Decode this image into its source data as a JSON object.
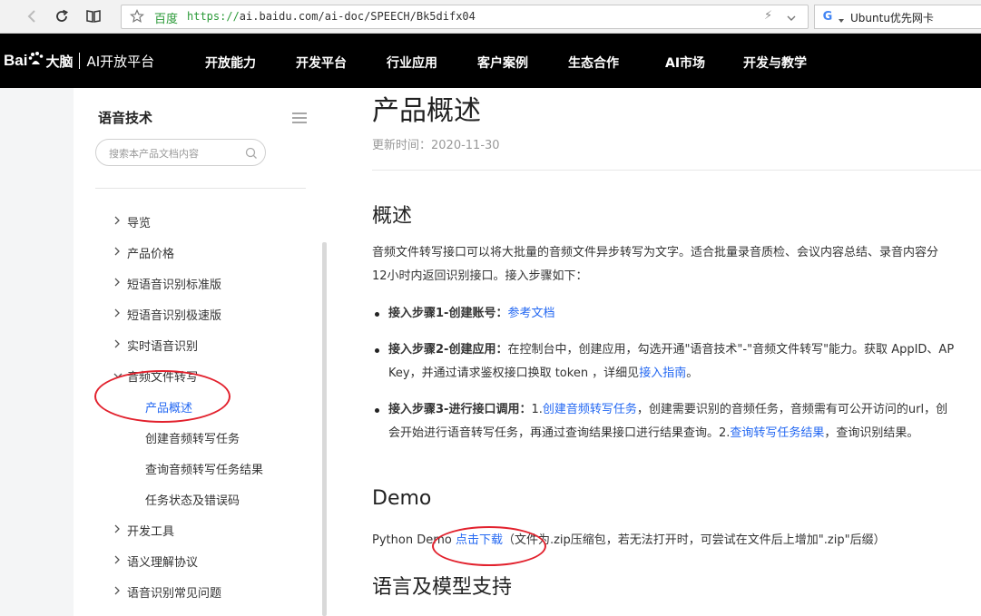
{
  "browser": {
    "brand_label": "百度",
    "url_scheme": "https://",
    "url_rest": "ai.baidu.com/ai-doc/SPEECH/Bk5difx04",
    "search_text": "Ubuntu优先网卡"
  },
  "header": {
    "logo_bai": "Bai",
    "logo_brain": "大脑",
    "logo_platform": "AI开放平台",
    "nav": [
      "开放能力",
      "开发平台",
      "行业应用",
      "客户案例",
      "生态合作",
      "AI市场",
      "开发与教学"
    ]
  },
  "sidebar": {
    "title": "语音技术",
    "search_placeholder": "搜索本产品文档内容",
    "items": [
      {
        "label": "导览"
      },
      {
        "label": "产品价格"
      },
      {
        "label": "短语音识别标准版"
      },
      {
        "label": "短语音识别极速版"
      },
      {
        "label": "实时语音识别"
      },
      {
        "label": "音频文件转写"
      },
      {
        "label": "产品概述"
      },
      {
        "label": "创建音频转写任务"
      },
      {
        "label": "查询音频转写任务结果"
      },
      {
        "label": "任务状态及错误码"
      },
      {
        "label": "开发工具"
      },
      {
        "label": "语义理解协议"
      },
      {
        "label": "语音识别常见问题"
      }
    ]
  },
  "content": {
    "title": "产品概述",
    "updated": "更新时间：2020-11-30",
    "overview_heading": "概述",
    "intro_line1": "音频文件转写接口可以将大批量的音频文件异步转写为文字。适合批量录音质检、会议内容总结、录音内容分",
    "intro_line2": "12小时内返回识别接口。接入步骤如下：",
    "step1_bold": "接入步骤1-创建账号：",
    "step1_link": "参考文档",
    "step2_bold": "接入步骤2-创建应用：",
    "step2_text": "在控制台中，创建应用，勾选开通\"语音技术\"-\"音频文件转写\"能力。获取 AppID、AP",
    "step2_line2": "Key，并通过请求鉴权接口换取 token ，详细见",
    "step2_link": "接入指南",
    "step2_end": "。",
    "step3_bold": "接入步骤3-进行接口调用：",
    "step3_pre": "1.",
    "step3_link1": "创建音频转写任务",
    "step3_text": "，创建需要识别的音频任务，音频需有可公开访问的url，创",
    "step3_line2": "会开始进行语音转写任务，再通过查询结果接口进行结果查询。2.",
    "step3_link2": "查询转写任务结果",
    "step3_end": "，查询识别结果。",
    "demo_heading": "Demo",
    "demo_pre": "Python Demo ",
    "demo_link": "点击下载",
    "demo_post": "（文件为.zip压缩包，若无法打开时，可尝试在文件后上增加\".zip\"后缀）",
    "lang_heading": "语言及模型支持"
  }
}
